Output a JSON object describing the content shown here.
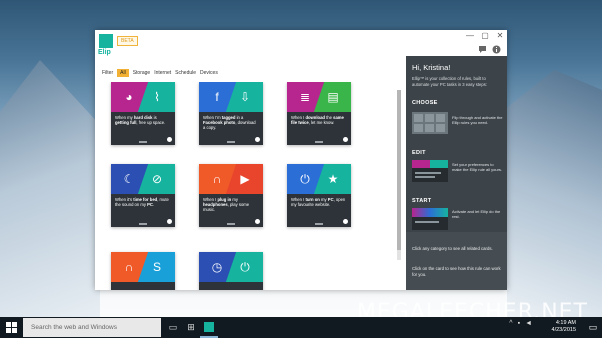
{
  "colors": {
    "teal": "#16b39f",
    "dark_card": "#2d3338",
    "panel_bg": "#3d4449",
    "beta_accent": "#f0b43c"
  },
  "app": {
    "logo": "Elip",
    "beta": "BETA",
    "window_buttons": [
      "—",
      "▢",
      "✕"
    ],
    "header_icons": [
      "feedback-icon",
      "info-icon"
    ]
  },
  "filter": {
    "label": "Filter",
    "items": [
      "All",
      "Storage",
      "Internet",
      "Schedule",
      "Devices"
    ],
    "active": "All"
  },
  "cards": [
    {
      "icons": [
        "pie-chart-icon",
        "broom-icon"
      ],
      "colors": [
        "#b7258f",
        "#16b39f"
      ],
      "text_pre": "When my ",
      "text_bold": "hard disk",
      "text_mid": " is ",
      "text_bold2": "getting full",
      "text_post": ", free up space."
    },
    {
      "icons": [
        "facebook-icon",
        "download-icon"
      ],
      "colors": [
        "#2b6fd6",
        "#16b39f"
      ],
      "text_pre": "When I'm ",
      "text_bold": "tagged",
      "text_mid": " in a ",
      "text_bold2": "Facebook photo",
      "text_post": ", download a copy."
    },
    {
      "icons": [
        "document-icon",
        "message-icon"
      ],
      "colors": [
        "#b7258f",
        "#39b54a"
      ],
      "text_pre": "When I ",
      "text_bold": "download",
      "text_mid": " the ",
      "text_bold2": "same file twice",
      "text_post": ", let me know."
    },
    {
      "icons": [
        "moon-icon",
        "mute-icon"
      ],
      "colors": [
        "#2b4fb3",
        "#16b39f"
      ],
      "text_pre": "When it's ",
      "text_bold": "time for bed",
      "text_mid": ", mute the sound on my ",
      "text_bold2": "PC",
      "text_post": "."
    },
    {
      "icons": [
        "headphones-icon",
        "play-icon"
      ],
      "colors": [
        "#f05a28",
        "#e8452c"
      ],
      "text_pre": "When I ",
      "text_bold": "plug in",
      "text_mid": " my ",
      "text_bold2": "headphones",
      "text_post": ", play some music."
    },
    {
      "icons": [
        "power-icon",
        "star-icon"
      ],
      "colors": [
        "#2b6fd6",
        "#16b39f"
      ],
      "text_pre": "When I ",
      "text_bold": "turn on",
      "text_mid": " my ",
      "text_bold2": "PC",
      "text_post": ", open my favourite website."
    },
    {
      "icons": [
        "headphones-icon",
        "skype-icon"
      ],
      "colors": [
        "#f05a28",
        "#1aa0d8"
      ],
      "text_pre": "",
      "text_bold": "",
      "text_mid": "",
      "text_bold2": "",
      "text_post": ""
    },
    {
      "icons": [
        "clock-icon",
        "power-icon"
      ],
      "colors": [
        "#2b4fb3",
        "#16b39f"
      ],
      "text_pre": "",
      "text_bold": "",
      "text_mid": "",
      "text_bold2": "",
      "text_post": ""
    }
  ],
  "panel": {
    "greeting": "Hi, Kristina!",
    "intro": "Ellip™ is your collection of rules, built to automate your PC tasks in 3 easy steps:",
    "steps": [
      {
        "title": "CHOOSE",
        "text": "Flip through and activate the Ellip rules you need."
      },
      {
        "title": "EDIT",
        "text": "Set your preferences to make the Ellip rule all yours."
      },
      {
        "title": "START",
        "text": "Activate and let Ellip do the rest."
      }
    ],
    "footer1": "Click any category to see all related cards.",
    "footer2": "Click on the card to see how this rule can work for you."
  },
  "taskbar": {
    "search_placeholder": "Search the web and Windows",
    "time": "4:19 AM",
    "date": "4/23/2015"
  },
  "watermark": "MEGALEECHER.NET"
}
